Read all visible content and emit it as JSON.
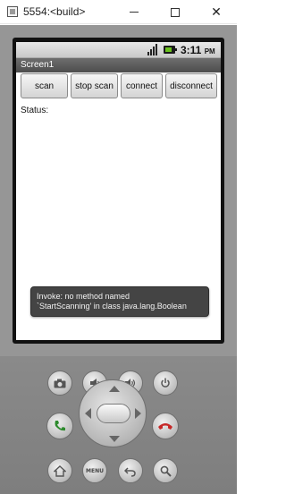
{
  "window": {
    "title": "5554:<build>",
    "minimize_glyph": "—",
    "maximize_glyph": "☐",
    "close_glyph": "✕"
  },
  "phone_status": {
    "time": "3:11",
    "ampm": "PM",
    "icons": [
      "signal-icon",
      "battery-icon"
    ]
  },
  "app": {
    "title": "Screen1",
    "buttons": [
      "scan",
      "stop scan",
      "connect",
      "disconnect"
    ],
    "status_label": "Status:"
  },
  "toast": {
    "line1": "Invoke: no method named",
    "line2": "`StartScanning' in class java.lang.Boolean"
  },
  "hardware_keys": {
    "row1": [
      "camera-icon",
      "volume-down-icon",
      "volume-up-icon",
      "power-icon"
    ],
    "row2": [
      "call-icon",
      "dpad",
      "end-call-icon"
    ],
    "row3": [
      "home-icon",
      "menu-key",
      "back-icon",
      "search-icon"
    ],
    "menu_label": "MENU"
  },
  "colors": {
    "emulator_body": "#969696",
    "call_green": "#2e8b2e",
    "end_red": "#c62828",
    "battery_green": "#6ac21e"
  }
}
